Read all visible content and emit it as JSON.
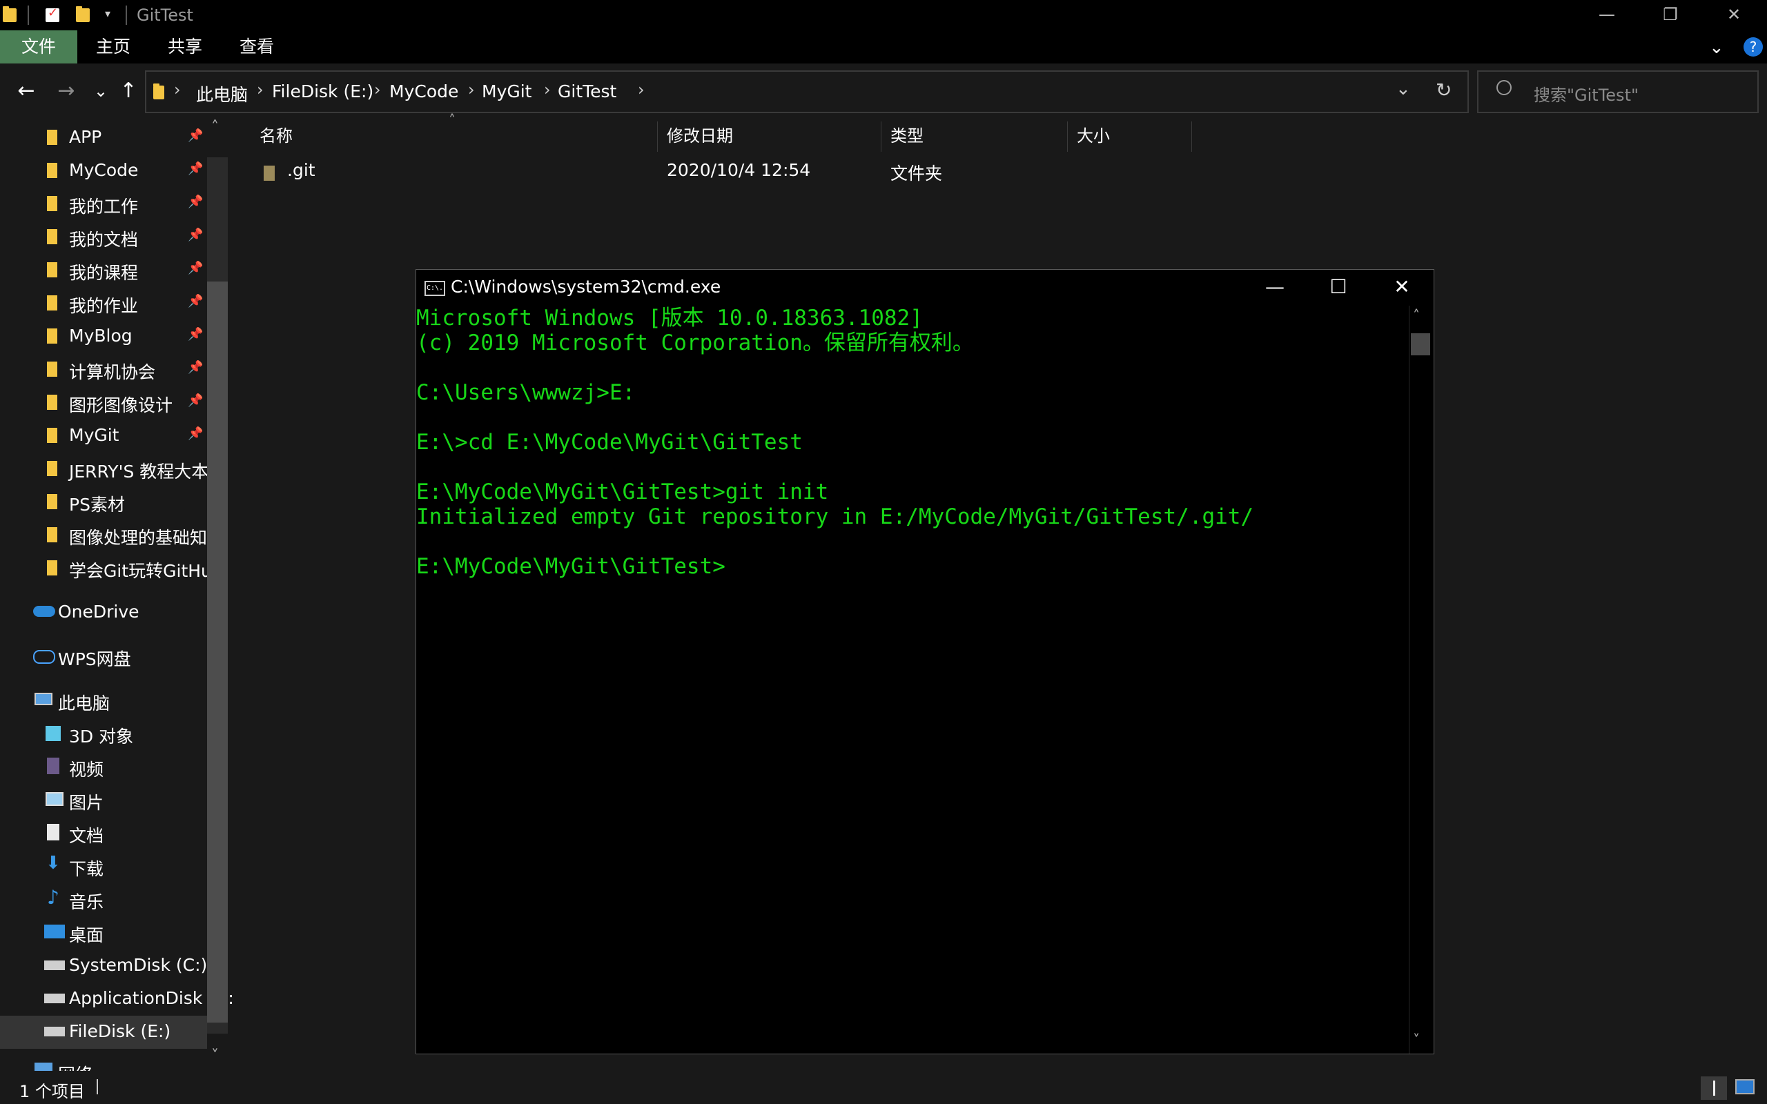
{
  "window": {
    "title": "GitTest",
    "controls": {
      "minimize": "—",
      "maximize": "❐",
      "close": "✕"
    }
  },
  "ribbon": {
    "tabs": [
      {
        "label": "文件",
        "active": true
      },
      {
        "label": "主页"
      },
      {
        "label": "共享"
      },
      {
        "label": "查看"
      }
    ],
    "help": "?"
  },
  "address": {
    "back": "←",
    "forward": "→",
    "recent": "⌄",
    "up": "↑",
    "crumbs": [
      "此电脑",
      "FileDisk (E:)",
      "MyCode",
      "MyGit",
      "GitTest"
    ],
    "separator": "›",
    "dropdown": "⌄",
    "refresh": "↻"
  },
  "search": {
    "placeholder": "搜索\"GitTest\"",
    "icon": "search-icon"
  },
  "nav": {
    "quick_access": [
      {
        "label": "APP",
        "pinned": true
      },
      {
        "label": "MyCode",
        "pinned": true
      },
      {
        "label": "我的工作",
        "pinned": true
      },
      {
        "label": "我的文档",
        "pinned": true
      },
      {
        "label": "我的课程",
        "pinned": true
      },
      {
        "label": "我的作业",
        "pinned": true
      },
      {
        "label": "MyBlog",
        "pinned": true
      },
      {
        "label": "计算机协会",
        "pinned": true
      },
      {
        "label": "图形图像设计",
        "pinned": true
      },
      {
        "label": "MyGit",
        "pinned": true
      },
      {
        "label": "JERRY'S 教程大本营"
      },
      {
        "label": "PS素材"
      },
      {
        "label": "图像处理的基础知识"
      },
      {
        "label": "学会Git玩转GitHub"
      }
    ],
    "pin_glyph": "📌",
    "onedrive": "OneDrive",
    "wps": "WPS网盘",
    "this_pc": "此电脑",
    "pc_items": [
      {
        "label": "3D 对象",
        "icon": "cube-icon"
      },
      {
        "label": "视频",
        "icon": "video-icon"
      },
      {
        "label": "图片",
        "icon": "picture-icon"
      },
      {
        "label": "文档",
        "icon": "document-icon"
      },
      {
        "label": "下载",
        "icon": "download-icon"
      },
      {
        "label": "音乐",
        "icon": "music-icon"
      },
      {
        "label": "桌面",
        "icon": "desktop-icon"
      },
      {
        "label": "SystemDisk (C:)",
        "icon": "drive-icon"
      },
      {
        "label": "ApplicationDisk (D:)",
        "icon": "drive-icon"
      },
      {
        "label": "FileDisk (E:)",
        "icon": "drive-icon",
        "selected": true
      }
    ],
    "network": "网络",
    "scroll_up": "˄",
    "scroll_down": "˅"
  },
  "filelist": {
    "headers": {
      "name": "名称",
      "modified": "修改日期",
      "type": "类型",
      "size": "大小"
    },
    "sort_indicator": "˄",
    "rows": [
      {
        "name": ".git",
        "modified": "2020/10/4 12:54",
        "type": "文件夹",
        "size": ""
      }
    ]
  },
  "status": {
    "count": "1 个项目"
  },
  "cmd": {
    "title": "C:\\Windows\\system32\\cmd.exe",
    "icon_text": "C:\\.",
    "controls": {
      "minimize": "—",
      "maximize": "☐",
      "close": "✕"
    },
    "lines": [
      "Microsoft Windows [版本 10.0.18363.1082]",
      "(c) 2019 Microsoft Corporation。保留所有权利。",
      "",
      "C:\\Users\\wwwzj>E:",
      "",
      "E:\\>cd E:\\MyCode\\MyGit\\GitTest",
      "",
      "E:\\MyCode\\MyGit\\GitTest>git init",
      "Initialized empty Git repository in E:/MyCode/MyGit/GitTest/.git/",
      "",
      "E:\\MyCode\\MyGit\\GitTest>"
    ],
    "text_color": "#18d818",
    "scroll_up": "˄",
    "scroll_down": "˅"
  },
  "colors": {
    "accent": "#4a7f55",
    "folder": "#f4c542",
    "bg": "#191919"
  }
}
